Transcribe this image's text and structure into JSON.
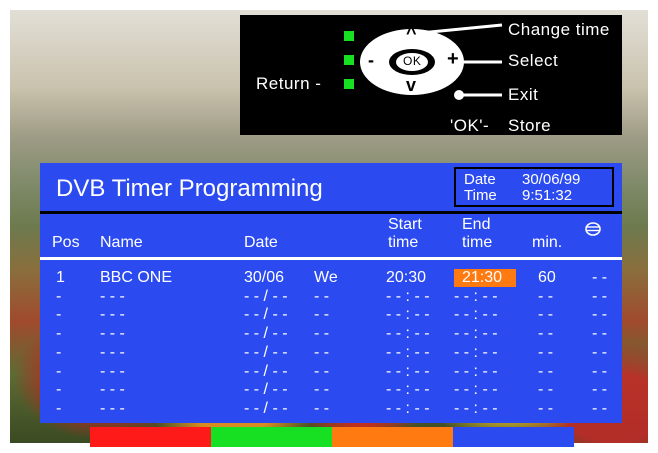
{
  "help": {
    "change_time": "Change time",
    "select": "Select",
    "exit": "Exit",
    "store": "Store",
    "return_label": "Return -",
    "ok_prefix": "'OK'-",
    "ok_button": "OK",
    "up_symbol": "^",
    "down_symbol": "v",
    "plus_symbol": "+",
    "minus_symbol": "-"
  },
  "panel": {
    "title": "DVB Timer Programming",
    "date_label": "Date",
    "date_value": "30/06/99",
    "time_label": "Time",
    "time_value": "9:51:32"
  },
  "columns": {
    "pos": "Pos",
    "name": "Name",
    "date": "Date",
    "start_1": "Start",
    "start_2": "time",
    "end_1": "End",
    "end_2": "time",
    "min": "min."
  },
  "rows": [
    {
      "pos": "1",
      "name": "BBC ONE",
      "date": "30/06",
      "day": "We",
      "start": "20:30",
      "end": "21:30",
      "min": "60",
      "repeat": "- -"
    },
    {
      "pos": "-",
      "name": "- - -",
      "date": "- - / - -",
      "day": "- -",
      "start": "- - : - -",
      "end": "- - : - -",
      "min": "- -",
      "repeat": "- -"
    },
    {
      "pos": "-",
      "name": "- - -",
      "date": "- - / - -",
      "day": "- -",
      "start": "- - : - -",
      "end": "- - : - -",
      "min": "- -",
      "repeat": "- -"
    },
    {
      "pos": "-",
      "name": "- - -",
      "date": "- - / - -",
      "day": "- -",
      "start": "- - : - -",
      "end": "- - : - -",
      "min": "- -",
      "repeat": "- -"
    },
    {
      "pos": "-",
      "name": "- - -",
      "date": "- - / - -",
      "day": "- -",
      "start": "- - : - -",
      "end": "- - : - -",
      "min": "- -",
      "repeat": "- -"
    },
    {
      "pos": "-",
      "name": "- - -",
      "date": "- - / - -",
      "day": "- -",
      "start": "- - : - -",
      "end": "- - : - -",
      "min": "- -",
      "repeat": "- -"
    },
    {
      "pos": "-",
      "name": "- - -",
      "date": "- - / - -",
      "day": "- -",
      "start": "- - : - -",
      "end": "- - : - -",
      "min": "- -",
      "repeat": "- -"
    },
    {
      "pos": "-",
      "name": "- - -",
      "date": "- - / - -",
      "day": "- -",
      "start": "- - : - -",
      "end": "- - : - -",
      "min": "- -",
      "repeat": "- -"
    }
  ],
  "colors": {
    "panel": "#2b4bf0",
    "highlight": "#ff7a10",
    "key_red": "#ff1a1a",
    "key_green": "#16e021",
    "key_yellow": "#ff7a10",
    "key_blue": "#2b4bf0"
  },
  "icons": {
    "repeat": "repeat-icon",
    "navigation": "remote-dpad-icon"
  }
}
